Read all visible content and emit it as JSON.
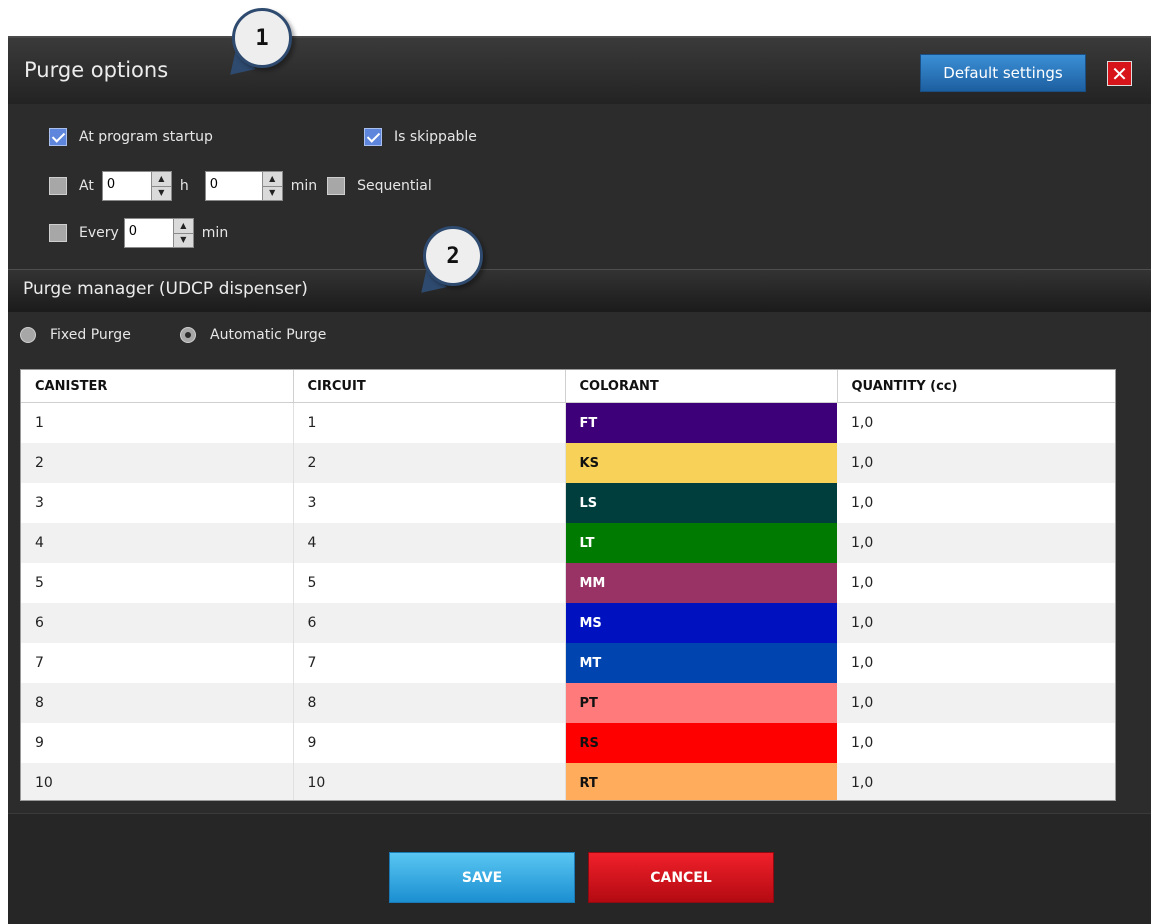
{
  "window": {
    "title": "Purge options",
    "default_settings": "Default settings",
    "close_glyph": "✕"
  },
  "options": {
    "startup": {
      "label": "At program startup",
      "checked": true
    },
    "skippable": {
      "label": "Is skippable",
      "checked": true
    },
    "at": {
      "label": "At",
      "hours_value": "0",
      "hours_unit": "h",
      "minutes_value": "0",
      "minutes_unit": "min",
      "checked": false
    },
    "sequential": {
      "label": "Sequential",
      "checked": false
    },
    "every": {
      "label": "Every",
      "value": "0",
      "unit": "min",
      "checked": false
    }
  },
  "purge_manager": {
    "title": "Purge manager (UDCP dispenser)",
    "fixed_label": "Fixed Purge",
    "automatic_label": "Automatic Purge",
    "selected": "Automatic Purge"
  },
  "table": {
    "headers": [
      "CANISTER",
      "CIRCUIT",
      "COLORANT",
      "QUANTITY (cc)"
    ],
    "rows": [
      {
        "canister": "1",
        "circuit": "1",
        "colorant": "FT",
        "color": "#3d0078",
        "text_color": "#ffffff",
        "quantity": "1,0"
      },
      {
        "canister": "2",
        "circuit": "2",
        "colorant": "KS",
        "color": "#f7d158",
        "text_color": "#111111",
        "quantity": "1,0"
      },
      {
        "canister": "3",
        "circuit": "3",
        "colorant": "LS",
        "color": "#003d3d",
        "text_color": "#ffffff",
        "quantity": "1,0"
      },
      {
        "canister": "4",
        "circuit": "4",
        "colorant": "LT",
        "color": "#007a00",
        "text_color": "#ffffff",
        "quantity": "1,0"
      },
      {
        "canister": "5",
        "circuit": "5",
        "colorant": "MM",
        "color": "#993366",
        "text_color": "#ffffff",
        "quantity": "1,0"
      },
      {
        "canister": "6",
        "circuit": "6",
        "colorant": "MS",
        "color": "#0012c0",
        "text_color": "#ffffff",
        "quantity": "1,0"
      },
      {
        "canister": "7",
        "circuit": "7",
        "colorant": "MT",
        "color": "#0044b0",
        "text_color": "#ffffff",
        "quantity": "1,0"
      },
      {
        "canister": "8",
        "circuit": "8",
        "colorant": "PT",
        "color": "#ff7b7b",
        "text_color": "#111111",
        "quantity": "1,0"
      },
      {
        "canister": "9",
        "circuit": "9",
        "colorant": "RS",
        "color": "#ff0000",
        "text_color": "#111111",
        "quantity": "1,0"
      },
      {
        "canister": "10",
        "circuit": "10",
        "colorant": "RT",
        "color": "#ffad5c",
        "text_color": "#111111",
        "quantity": "1,0"
      }
    ]
  },
  "buttons": {
    "save": "SAVE",
    "cancel": "CANCEL"
  },
  "callouts": [
    {
      "label": "1"
    },
    {
      "label": "2"
    }
  ],
  "colors": {
    "save": "#1b8fd1",
    "cancel": "#d8141b",
    "accent": "#2e4a6f"
  }
}
